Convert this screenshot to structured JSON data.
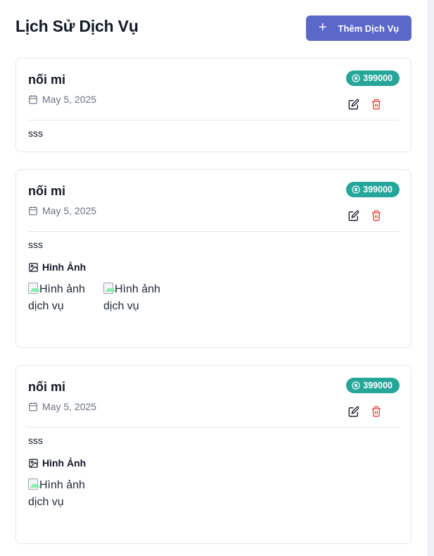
{
  "header": {
    "title": "Lịch Sử Dịch Vụ",
    "add_button_label": "Thêm Dịch Vụ"
  },
  "services": [
    {
      "name": "nối mi",
      "date": "May 5, 2025",
      "price": "399000",
      "description": "sss",
      "images_label": "",
      "images": []
    },
    {
      "name": "nối mi",
      "date": "May 5, 2025",
      "price": "399000",
      "description": "sss",
      "images_label": "Hình Ảnh",
      "images": [
        "Hình ảnh dịch vụ",
        "Hình ảnh dịch vụ"
      ]
    },
    {
      "name": "nối mi",
      "date": "May 5, 2025",
      "price": "399000",
      "description": "sss",
      "images_label": "Hình Ảnh",
      "images": [
        "Hình ảnh dịch vụ"
      ]
    }
  ],
  "colors": {
    "accent": "#5b67c9",
    "price_badge": "#26a69a",
    "delete": "#e53e3e"
  },
  "icons": [
    "plus-icon",
    "calendar-icon",
    "dollar-circle-icon",
    "edit-icon",
    "trash-icon",
    "image-icon"
  ]
}
